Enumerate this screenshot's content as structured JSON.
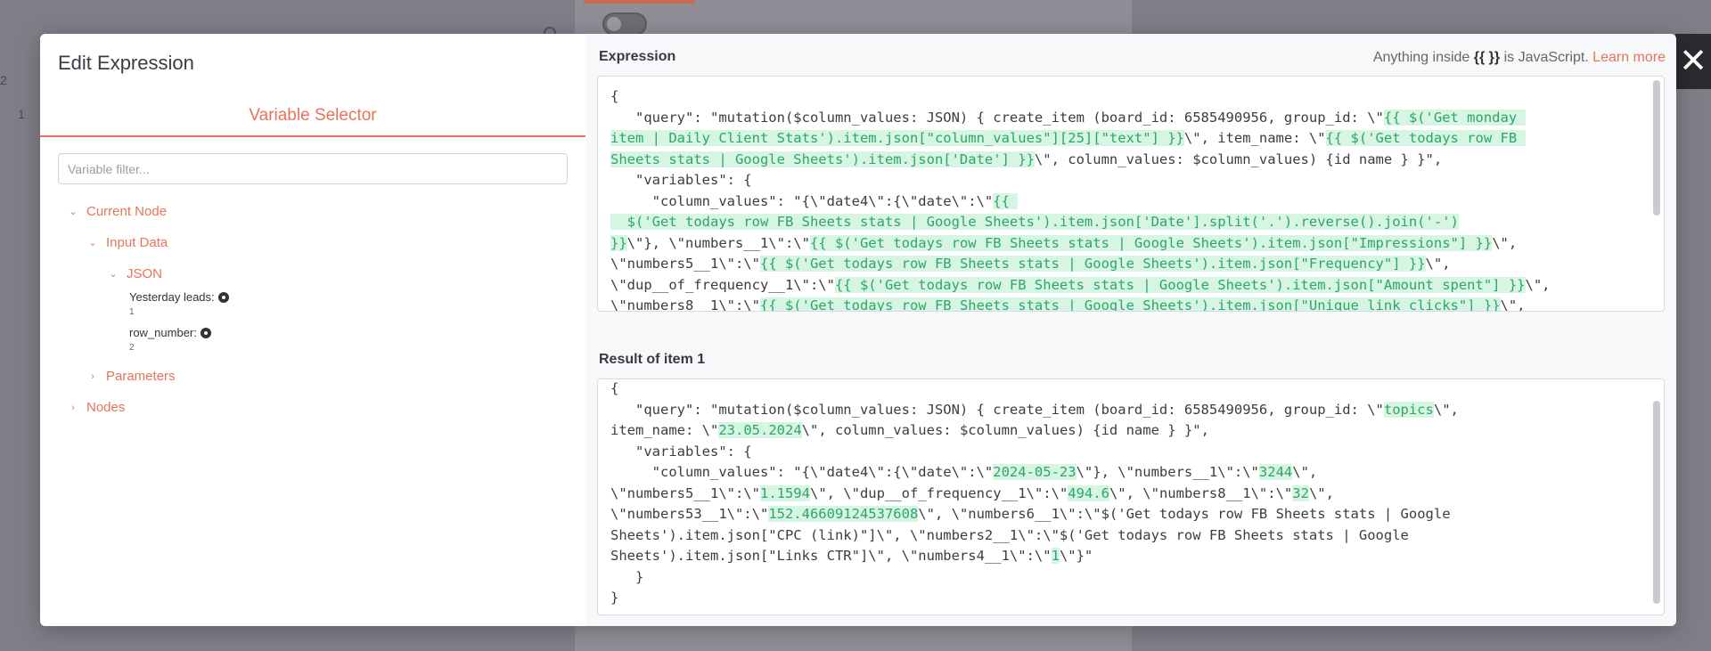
{
  "background": {
    "nums": [
      "2",
      "1"
    ]
  },
  "modal": {
    "title": "Edit Expression",
    "variable_selector": {
      "tab_label": "Variable Selector",
      "filter_placeholder": "Variable filter...",
      "tree": {
        "current_node": "Current Node",
        "input_data": "Input Data",
        "json": "JSON",
        "fields": [
          {
            "label": "Yesterday leads:",
            "value": "1"
          },
          {
            "label": "row_number:",
            "value": "2"
          }
        ],
        "parameters": "Parameters",
        "nodes": "Nodes"
      }
    },
    "expression": {
      "label": "Expression",
      "hint_prefix": "Anything inside ",
      "hint_braces": "{{ }}",
      "hint_suffix": " is JavaScript. ",
      "learn_more": "Learn more",
      "lines": [
        [
          {
            "t": "{"
          }
        ],
        [
          {
            "t": "   \"query\": \"mutation($column_values: JSON) { create_item (board_id: 6585490956, group_id: \\\""
          },
          {
            "t": "{{ $('Get monday ",
            "h": true
          }
        ],
        [
          {
            "t": "item | Daily Client Stats').item.json[\"column_values\"][25][\"text\"] }}",
            "h": true
          },
          {
            "t": "\\\", item_name: \\\""
          },
          {
            "t": "{{ $('Get todays row FB ",
            "h": true
          }
        ],
        [
          {
            "t": "Sheets stats | Google Sheets').item.json['Date'] }}",
            "h": true
          },
          {
            "t": "\\\", column_values: $column_values) {id name } }\","
          }
        ],
        [
          {
            "t": "   \"variables\": {"
          }
        ],
        [
          {
            "t": "     \"column_values\": \"{\\\"date4\\\":{\\\"date\\\":\\\""
          },
          {
            "t": "{{ ",
            "h": true
          }
        ],
        [
          {
            "t": "  $('Get todays row FB Sheets stats | Google Sheets').item.json['Date'].split('.').reverse().join('-')",
            "h": true
          }
        ],
        [
          {
            "t": "}}",
            "h": true
          },
          {
            "t": "\\\"}, \\\"numbers__1\\\":\\\""
          },
          {
            "t": "{{ $('Get todays row FB Sheets stats | Google Sheets').item.json[\"Impressions\"] }}",
            "h": true
          },
          {
            "t": "\\\","
          }
        ],
        [
          {
            "t": "\\\"numbers5__1\\\":\\\""
          },
          {
            "t": "{{ $('Get todays row FB Sheets stats | Google Sheets').item.json[\"Frequency\"] }}",
            "h": true
          },
          {
            "t": "\\\","
          }
        ],
        [
          {
            "t": "\\\"dup__of_frequency__1\\\":\\\""
          },
          {
            "t": "{{ $('Get todays row FB Sheets stats | Google Sheets').item.json[\"Amount spent\"] }}",
            "h": true
          },
          {
            "t": "\\\","
          }
        ],
        [
          {
            "t": "\\\"numbers8__1\\\":\\\""
          },
          {
            "t": "{{ $('Get todays row FB Sheets stats | Google Sheets').item.json[\"Unique link clicks\"] }}",
            "h": true
          },
          {
            "t": "\\\","
          }
        ]
      ]
    },
    "result": {
      "label": "Result of item 1",
      "lines": [
        [
          {
            "t": "{"
          }
        ],
        [
          {
            "t": "   \"query\": \"mutation($column_values: JSON) { create_item (board_id: 6585490956, group_id: \\\""
          },
          {
            "t": "topics",
            "h": true
          },
          {
            "t": "\\\","
          }
        ],
        [
          {
            "t": "item_name: \\\""
          },
          {
            "t": "23.05.2024",
            "h": true
          },
          {
            "t": "\\\", column_values: $column_values) {id name } }\","
          }
        ],
        [
          {
            "t": "   \"variables\": {"
          }
        ],
        [
          {
            "t": "     \"column_values\": \"{\\\"date4\\\":{\\\"date\\\":\\\""
          },
          {
            "t": "2024-05-23",
            "h": true
          },
          {
            "t": "\\\"}, \\\"numbers__1\\\":\\\""
          },
          {
            "t": "3244",
            "h": true
          },
          {
            "t": "\\\","
          }
        ],
        [
          {
            "t": "\\\"numbers5__1\\\":\\\""
          },
          {
            "t": "1.1594",
            "h": true
          },
          {
            "t": "\\\", \\\"dup__of_frequency__1\\\":\\\""
          },
          {
            "t": "494.6",
            "h": true
          },
          {
            "t": "\\\", \\\"numbers8__1\\\":\\\""
          },
          {
            "t": "32",
            "h": true
          },
          {
            "t": "\\\","
          }
        ],
        [
          {
            "t": "\\\"numbers53__1\\\":\\\""
          },
          {
            "t": "152.46609124537608",
            "h": true
          },
          {
            "t": "\\\", \\\"numbers6__1\\\":\\\"$('Get todays row FB Sheets stats | Google"
          }
        ],
        [
          {
            "t": "Sheets').item.json[\"CPC (link)\"]\\\", \\\"numbers2__1\\\":\\\"$('Get todays row FB Sheets stats | Google"
          }
        ],
        [
          {
            "t": "Sheets').item.json[\"Links CTR\"]\\\", \\\"numbers4__1\\\":\\\""
          },
          {
            "t": "1",
            "h": true
          },
          {
            "t": "\\\"}\""
          }
        ],
        [
          {
            "t": "   }"
          }
        ],
        [
          {
            "t": "}"
          }
        ]
      ]
    }
  },
  "colors": {
    "accent": "#e8735b",
    "highlight_bg": "#d7f5e3",
    "highlight_text": "#2ea56a"
  }
}
